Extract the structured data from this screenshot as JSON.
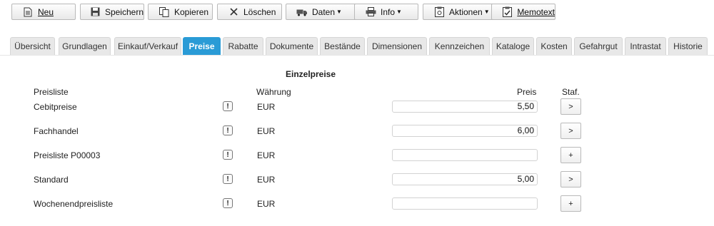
{
  "toolbar": {
    "new_label": "Neu",
    "save_label": "Speichern",
    "copy_label": "Kopieren",
    "delete_label": "Löschen",
    "data_label": "Daten",
    "info_label": "Info",
    "actions_label": "Aktionen",
    "memo_label": "Memotext"
  },
  "tabs": [
    "Übersicht",
    "Grundlagen",
    "Einkauf/Verkauf",
    "Preise",
    "Rabatte",
    "Dokumente",
    "Bestände",
    "Dimensionen",
    "Kennzeichen",
    "Kataloge",
    "Kosten",
    "Gefahrgut",
    "Intrastat",
    "Historie"
  ],
  "active_tab": "Preise",
  "section_title": "Einzelpreise",
  "headers": {
    "pricelist": "Preisliste",
    "currency": "Währung",
    "price": "Preis",
    "staf": "Staf."
  },
  "rows": [
    {
      "name": "Cebitpreise",
      "warn": "!",
      "currency": "EUR",
      "price": "5,50",
      "staf": ">"
    },
    {
      "name": "Fachhandel",
      "warn": "!",
      "currency": "EUR",
      "price": "6,00",
      "staf": ">"
    },
    {
      "name": "Preisliste P00003",
      "warn": "!",
      "currency": "EUR",
      "price": "",
      "staf": "+"
    },
    {
      "name": "Standard",
      "warn": "!",
      "currency": "EUR",
      "price": "5,00",
      "staf": ">"
    },
    {
      "name": "Wochenendpreisliste",
      "warn": "!",
      "currency": "EUR",
      "price": "",
      "staf": "+"
    }
  ],
  "colors": {
    "active_tab": "#2a9bd6",
    "tab_bg": "#e8e8e8"
  }
}
